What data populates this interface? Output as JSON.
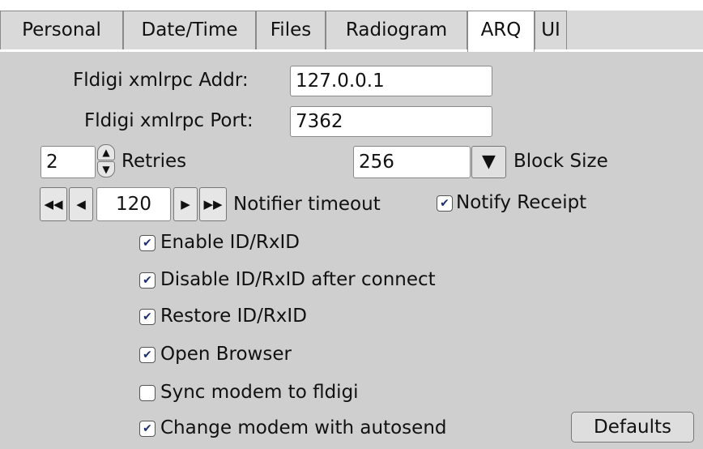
{
  "tabs": [
    "Personal",
    "Date/Time",
    "Files",
    "Radiogram",
    "ARQ",
    "UI"
  ],
  "active_tab": "ARQ",
  "arq": {
    "xmlrpc_addr_label": "Fldigi xmlrpc Addr:",
    "xmlrpc_addr_value": "127.0.0.1",
    "xmlrpc_port_label": "Fldigi xmlrpc Port:",
    "xmlrpc_port_value": "7362",
    "retries_value": "2",
    "retries_label": "Retries",
    "block_size_value": "256",
    "block_size_label": "Block Size",
    "notifier_value": "120",
    "notifier_label": "Notifier timeout",
    "notify_receipt_label": "Notify Receipt",
    "notify_receipt_checked": true,
    "options": [
      {
        "label": "Enable ID/RxID",
        "checked": true
      },
      {
        "label": "Disable ID/RxID after connect",
        "checked": true
      },
      {
        "label": "Restore ID/RxID",
        "checked": true
      },
      {
        "label": "Open Browser",
        "checked": true
      },
      {
        "label": "Sync modem to fldigi",
        "checked": false
      },
      {
        "label": "Change modem with autosend",
        "checked": true
      }
    ],
    "defaults_label": "Defaults"
  },
  "icons": {
    "check": "✔",
    "spin_up": "▲",
    "spin_down": "▼",
    "dropdown": "▼",
    "fast_back": "◀◀",
    "back": "◀",
    "forward": "▶",
    "fast_forward": "▶▶"
  }
}
